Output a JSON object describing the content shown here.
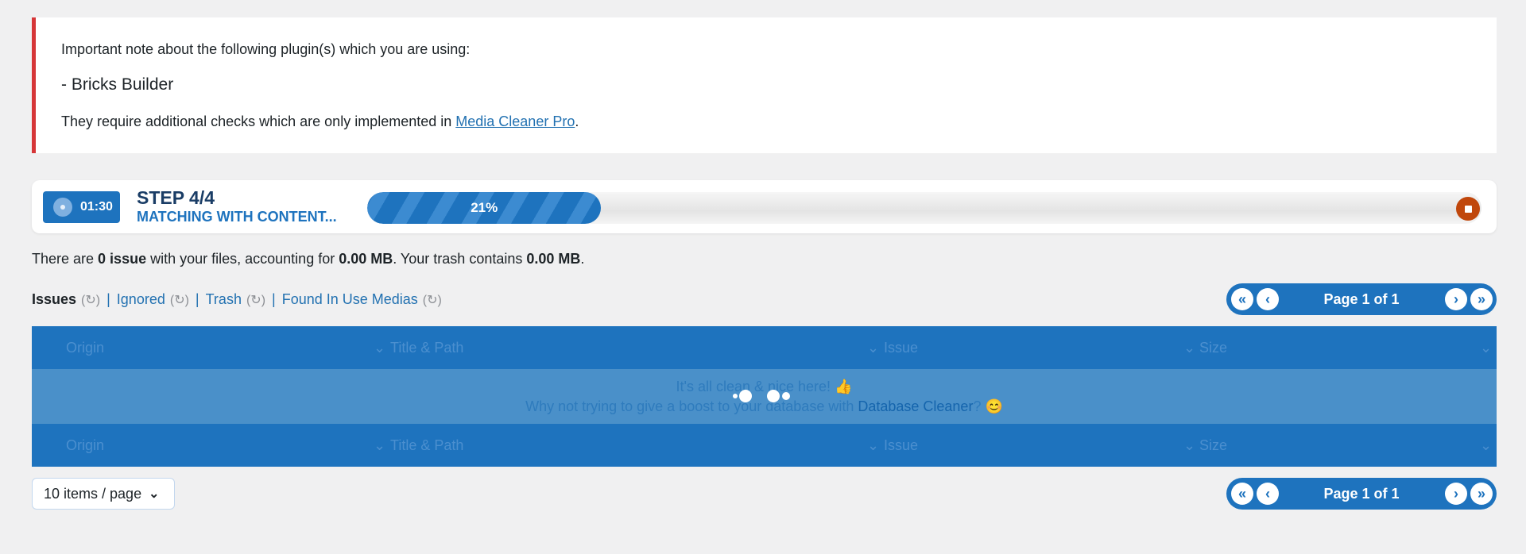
{
  "notice": {
    "line1": "Important note about the following plugin(s) which you are using:",
    "plugin": "- Bricks Builder",
    "line3_prefix": "They require additional checks which are only implemented in ",
    "link": "Media Cleaner Pro",
    "line3_suffix": "."
  },
  "scan": {
    "timer": "01:30",
    "step": "STEP 4/4",
    "status": "MATCHING WITH CONTENT...",
    "progress_label": "21%",
    "progress_percent": 21
  },
  "summary": {
    "part1": "There are ",
    "issue_count": "0 issue",
    "part2": " with your files, accounting for ",
    "size": "0.00 MB",
    "part3": ". Your trash contains ",
    "trash_size": "0.00 MB",
    "part4": "."
  },
  "filters": {
    "issues": "Issues",
    "ignored": "Ignored",
    "trash": "Trash",
    "found_in_use": "Found In Use Medias",
    "separator": "|"
  },
  "pagination": {
    "page_text": "Page 1 of 1"
  },
  "table": {
    "columns": [
      "Origin",
      "Title & Path",
      "Issue",
      "Size"
    ],
    "empty_line1": "It's all clean & nice here! 👍",
    "empty_line2_prefix": "Why not trying to give a boost to your database with ",
    "empty_link": "Database Cleaner",
    "empty_line2_suffix": "? 😊"
  },
  "per_page": {
    "label": "10 items / page"
  },
  "colors": {
    "accent": "#1e73be",
    "danger": "#d63638",
    "stop": "#c0470c"
  }
}
